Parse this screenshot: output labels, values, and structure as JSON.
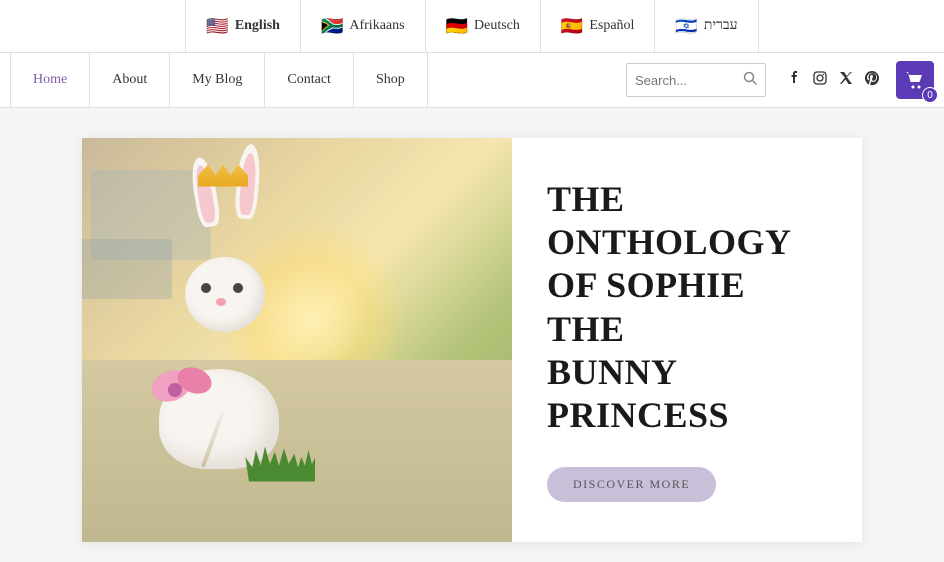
{
  "lang_bar": {
    "items": [
      {
        "id": "english",
        "flag": "🇺🇸",
        "label": "English",
        "active": true
      },
      {
        "id": "afrikaans",
        "flag": "🇿🇦",
        "label": "Afrikaans",
        "active": false
      },
      {
        "id": "deutsch",
        "flag": "🇩🇪",
        "label": "Deutsch",
        "active": false
      },
      {
        "id": "espanol",
        "flag": "🇪🇸",
        "label": "Español",
        "active": false
      },
      {
        "id": "hebrew",
        "flag": "🇮🇱",
        "label": "עברית",
        "active": false
      }
    ]
  },
  "nav": {
    "links": [
      {
        "id": "home",
        "label": "Home",
        "active": true
      },
      {
        "id": "about",
        "label": "About",
        "active": false
      },
      {
        "id": "my-blog",
        "label": "My Blog",
        "active": false
      },
      {
        "id": "contact",
        "label": "Contact",
        "active": false
      },
      {
        "id": "shop",
        "label": "Shop",
        "active": false
      }
    ],
    "search_placeholder": "Search...",
    "cart_count": "0",
    "social": [
      {
        "id": "facebook",
        "icon": "f",
        "label": "Facebook"
      },
      {
        "id": "instagram",
        "icon": "◉",
        "label": "Instagram"
      },
      {
        "id": "twitter",
        "icon": "𝕏",
        "label": "Twitter"
      },
      {
        "id": "pinterest",
        "icon": "𝐏",
        "label": "Pinterest"
      }
    ]
  },
  "hero": {
    "title_line1": "THE ONTHOLOGY",
    "title_line2": "OF SOPHIE THE",
    "title_line3": "BUNNY PRINCESS",
    "cta_label": "DISCOVER MORE"
  }
}
